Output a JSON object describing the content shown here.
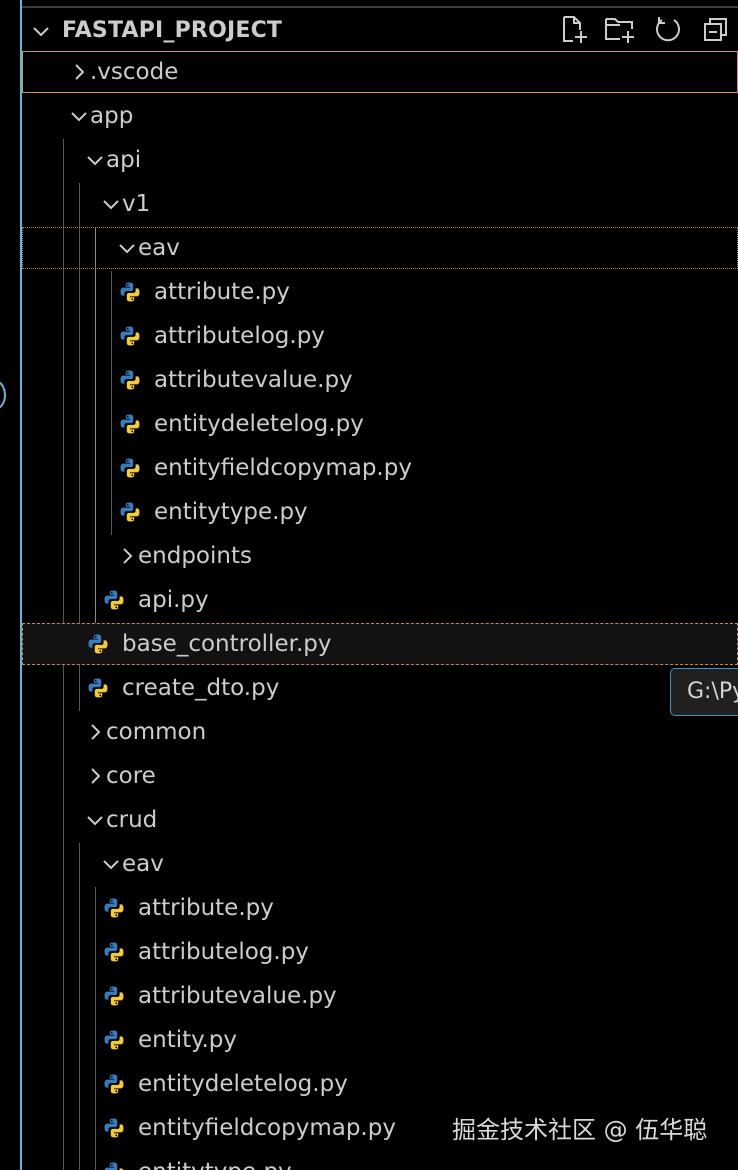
{
  "explorer": {
    "title": "FASTAPI_PROJECT",
    "actions": [
      {
        "name": "new-file",
        "icon": "new-file-icon"
      },
      {
        "name": "new-folder",
        "icon": "new-folder-icon"
      },
      {
        "name": "refresh",
        "icon": "refresh-icon"
      },
      {
        "name": "collapse-all",
        "icon": "collapse-all-icon"
      }
    ]
  },
  "tree": [
    {
      "label": ".vscode",
      "type": "folder",
      "expanded": false
    },
    {
      "label": "app",
      "type": "folder",
      "expanded": true
    },
    {
      "label": "api",
      "type": "folder",
      "expanded": true
    },
    {
      "label": "v1",
      "type": "folder",
      "expanded": true
    },
    {
      "label": "eav",
      "type": "folder",
      "expanded": true
    },
    {
      "label": "attribute.py",
      "type": "python-file"
    },
    {
      "label": "attributelog.py",
      "type": "python-file"
    },
    {
      "label": "attributevalue.py",
      "type": "python-file"
    },
    {
      "label": "entitydeletelog.py",
      "type": "python-file"
    },
    {
      "label": "entityfieldcopymap.py",
      "type": "python-file"
    },
    {
      "label": "entitytype.py",
      "type": "python-file"
    },
    {
      "label": "endpoints",
      "type": "folder",
      "expanded": false
    },
    {
      "label": "api.py",
      "type": "python-file"
    },
    {
      "label": "base_controller.py",
      "type": "python-file"
    },
    {
      "label": "create_dto.py",
      "type": "python-file"
    },
    {
      "label": "common",
      "type": "folder",
      "expanded": false
    },
    {
      "label": "core",
      "type": "folder",
      "expanded": false
    },
    {
      "label": "crud",
      "type": "folder",
      "expanded": true
    },
    {
      "label": "eav",
      "type": "folder",
      "expanded": true
    },
    {
      "label": "attribute.py",
      "type": "python-file"
    },
    {
      "label": "attributelog.py",
      "type": "python-file"
    },
    {
      "label": "attributevalue.py",
      "type": "python-file"
    },
    {
      "label": "entity.py",
      "type": "python-file"
    },
    {
      "label": "entitydeletelog.py",
      "type": "python-file"
    },
    {
      "label": "entityfieldcopymap.py",
      "type": "python-file"
    },
    {
      "label": "entitytype.py",
      "type": "python-file"
    }
  ],
  "tooltip": {
    "text": "G:\\Py"
  },
  "watermark": "掘金技术社区 @ 伍华聪",
  "colors": {
    "background": "#000000",
    "text": "#cccccc",
    "python_blue": "#3b7bbf",
    "python_yellow": "#f4ca3e",
    "accent": "#6fb3d7",
    "selection_border": "#d0925a"
  }
}
